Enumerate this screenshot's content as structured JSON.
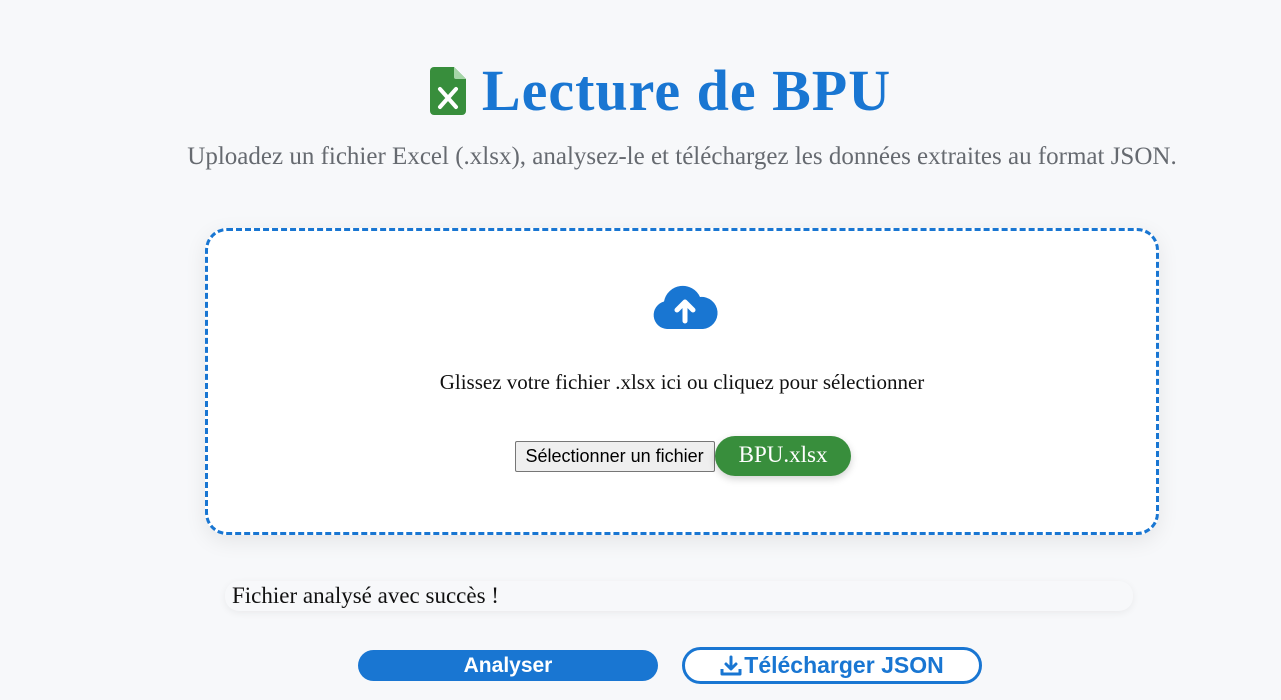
{
  "header": {
    "title": "Lecture de BPU",
    "subtitle": "Uploadez un fichier Excel (.xlsx), analysez-le et téléchargez les données extraites au format JSON."
  },
  "dropzone": {
    "instruction": "Glissez votre fichier .xlsx ici ou cliquez pour sélectionner",
    "select_button_label": "Sélectionner un fichier",
    "selected_file_name": "BPU.xlsx"
  },
  "status": {
    "message": "Fichier analysé avec succès !"
  },
  "actions": {
    "analyze_label": "Analyser",
    "download_label": "Télécharger JSON"
  },
  "colors": {
    "accent": "#1976d2",
    "success": "#388e3c",
    "background": "#f7f8fa",
    "muted_text": "#666a70"
  },
  "icons": {
    "title": "excel-file-icon",
    "dropzone": "cloud-upload-icon",
    "download": "download-icon"
  }
}
